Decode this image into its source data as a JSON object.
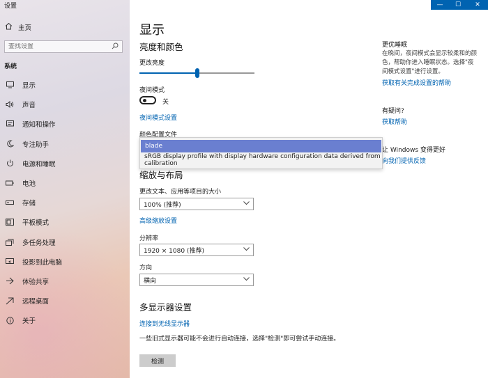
{
  "window": {
    "title": "设置",
    "controls": {
      "minimize": "—",
      "maximize": "☐",
      "close": "✕"
    }
  },
  "sidebar": {
    "home_label": "主页",
    "search_placeholder": "查找设置",
    "section_title": "系统",
    "items": [
      {
        "label": "显示",
        "icon": "monitor-icon"
      },
      {
        "label": "声音",
        "icon": "speaker-icon"
      },
      {
        "label": "通知和操作",
        "icon": "notification-icon"
      },
      {
        "label": "专注助手",
        "icon": "moon-icon"
      },
      {
        "label": "电源和睡眠",
        "icon": "power-icon"
      },
      {
        "label": "电池",
        "icon": "battery-icon"
      },
      {
        "label": "存储",
        "icon": "storage-icon"
      },
      {
        "label": "平板模式",
        "icon": "tablet-icon"
      },
      {
        "label": "多任务处理",
        "icon": "multitask-icon"
      },
      {
        "label": "投影到此电脑",
        "icon": "projector-icon"
      },
      {
        "label": "体验共享",
        "icon": "share-icon"
      },
      {
        "label": "远程桌面",
        "icon": "remote-icon"
      },
      {
        "label": "关于",
        "icon": "info-icon"
      }
    ]
  },
  "main": {
    "page_title": "显示",
    "brightness": {
      "heading": "亮度和颜色",
      "label": "更改亮度",
      "value_fraction": 0.5
    },
    "night_light": {
      "label": "夜间模式",
      "state": "关",
      "settings_link": "夜间模式设置"
    },
    "color_profile": {
      "label": "颜色配置文件",
      "options": [
        "blade",
        "sRGB display profile with display hardware configuration data derived from calibration"
      ],
      "selected_index": 0
    },
    "scale_layout": {
      "heading": "缩放与布局",
      "scale_label": "更改文本、应用等项目的大小",
      "scale_value": "100% (推荐)",
      "advanced_link": "高级缩放设置",
      "resolution_label": "分辨率",
      "resolution_value": "1920 × 1080 (推荐)",
      "orientation_label": "方向",
      "orientation_value": "横向"
    },
    "multi_display": {
      "heading": "多显示器设置",
      "wireless_link": "连接到无线显示器",
      "note": "一些旧式显示器可能不会进行自动连接，选择\"检测\"即可尝试手动连接。",
      "detect_button": "检测"
    }
  },
  "right": {
    "sleep": {
      "heading": "更优睡眠",
      "desc_lines": [
        "在晚间，夜间模式会显示较柔和的颜",
        "色，帮助你进入睡眠状态。选择\"夜",
        "间模式设置\"进行设置。"
      ],
      "link": "获取有关完成设置的帮助"
    },
    "help": {
      "heading": "有疑问?",
      "link": "获取帮助"
    },
    "feedback": {
      "heading": "让 Windows 变得更好",
      "link": "向我们提供反馈"
    }
  },
  "colors": {
    "accent": "#0063b1",
    "selection": "#6a7fd0",
    "button_bg": "#cccccc"
  }
}
